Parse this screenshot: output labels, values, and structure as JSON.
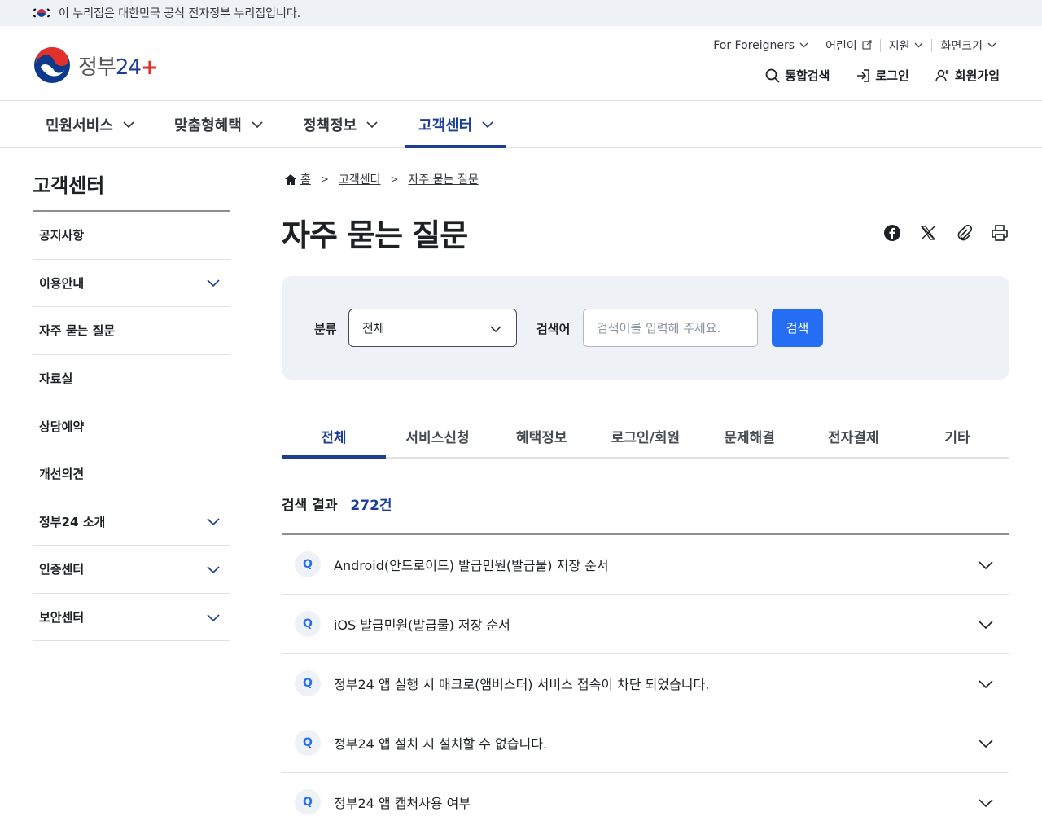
{
  "gov_banner": {
    "text": "이 누리집은 대한민국 공식 전자정부 누리집입니다."
  },
  "logo": {
    "text_main": "정부",
    "text_num": "2",
    "text_num2": "4"
  },
  "util_top": [
    {
      "label": "For Foreigners",
      "icon": "chevron-down-icon"
    },
    {
      "label": "어린이",
      "icon": "external-link-icon"
    },
    {
      "label": "지원",
      "icon": "chevron-down-icon"
    },
    {
      "label": "화면크기",
      "icon": "chevron-down-icon"
    }
  ],
  "util_bottom": [
    {
      "label": "통합검색",
      "icon": "search-icon"
    },
    {
      "label": "로그인",
      "icon": "login-icon"
    },
    {
      "label": "회원가입",
      "icon": "user-plus-icon"
    }
  ],
  "gnb": [
    {
      "label": "민원서비스",
      "active": false
    },
    {
      "label": "맞춤형혜택",
      "active": false
    },
    {
      "label": "정책정보",
      "active": false
    },
    {
      "label": "고객센터",
      "active": true
    }
  ],
  "sidebar": {
    "title": "고객센터",
    "items": [
      {
        "label": "공지사항",
        "expandable": false
      },
      {
        "label": "이용안내",
        "expandable": true
      },
      {
        "label": "자주 묻는 질문",
        "expandable": false
      },
      {
        "label": "자료실",
        "expandable": false
      },
      {
        "label": "상담예약",
        "expandable": false
      },
      {
        "label": "개선의견",
        "expandable": false
      },
      {
        "label": "정부24 소개",
        "expandable": true
      },
      {
        "label": "인증센터",
        "expandable": true
      },
      {
        "label": "보안센터",
        "expandable": true
      }
    ]
  },
  "breadcrumb": {
    "home": "홈",
    "level1": "고객센터",
    "level2": "자주 묻는 질문"
  },
  "page_title": "자주 묻는 질문",
  "share_icons": [
    "facebook-icon",
    "x-icon",
    "link-icon",
    "print-icon"
  ],
  "search": {
    "category_label": "분류",
    "category_value": "전체",
    "keyword_label": "검색어",
    "keyword_placeholder": "검색어를 입력해 주세요.",
    "button_label": "검색"
  },
  "tabs": [
    {
      "label": "전체",
      "active": true
    },
    {
      "label": "서비스신청",
      "active": false
    },
    {
      "label": "혜택정보",
      "active": false
    },
    {
      "label": "로그인/회원",
      "active": false
    },
    {
      "label": "문제해결",
      "active": false
    },
    {
      "label": "전자결제",
      "active": false
    },
    {
      "label": "기타",
      "active": false
    }
  ],
  "result": {
    "label": "검색 결과",
    "count": "272건"
  },
  "faq": {
    "badge": "Q",
    "items": [
      "Android(안드로이드) 발급민원(발급물) 저장 순서",
      "iOS 발급민원(발급물) 저장 순서",
      "정부24 앱 실행 시 매크로(앰버스터) 서비스 접속이 차단 되었습니다.",
      "정부24 앱 설치 시 설치할 수 없습니다.",
      "정부24 앱 캡처사용 여부"
    ]
  },
  "colors": {
    "brand": "#1c3f94",
    "accent": "#256ef4",
    "panel": "#eef2f7"
  }
}
